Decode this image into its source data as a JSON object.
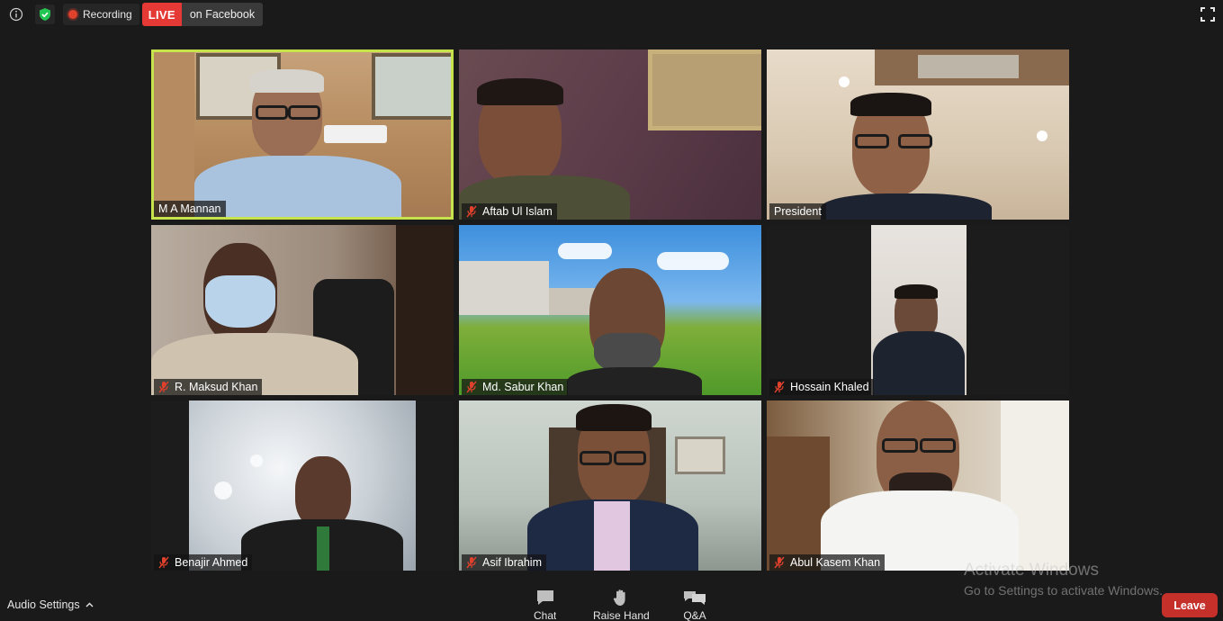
{
  "topbar": {
    "info_icon": "info-icon",
    "security_icon": "shield-check-icon",
    "recording_label": "Recording",
    "live_badge": "LIVE",
    "live_target": "on Facebook",
    "fullscreen_icon": "fullscreen-icon"
  },
  "participants": [
    {
      "name": "M A Mannan",
      "muted": false,
      "active_speaker": true
    },
    {
      "name": "Aftab Ul Islam",
      "muted": true,
      "active_speaker": false
    },
    {
      "name": "President",
      "muted": false,
      "active_speaker": false
    },
    {
      "name": "R. Maksud Khan",
      "muted": true,
      "active_speaker": false
    },
    {
      "name": "Md. Sabur Khan",
      "muted": true,
      "active_speaker": false
    },
    {
      "name": "Hossain Khaled",
      "muted": true,
      "active_speaker": false
    },
    {
      "name": "Benajir Ahmed",
      "muted": true,
      "active_speaker": false
    },
    {
      "name": "Asif Ibrahim",
      "muted": true,
      "active_speaker": false
    },
    {
      "name": "Abul Kasem Khan",
      "muted": true,
      "active_speaker": false
    }
  ],
  "bottombar": {
    "audio_settings": "Audio Settings",
    "controls": [
      {
        "label": "Chat",
        "icon": "chat-icon"
      },
      {
        "label": "Raise Hand",
        "icon": "hand-icon"
      },
      {
        "label": "Q&A",
        "icon": "qa-icon"
      }
    ],
    "leave": "Leave"
  },
  "watermark": {
    "title": "Activate Windows",
    "subtitle": "Go to Settings to activate Windows."
  },
  "colors": {
    "background": "#1a1a1a",
    "active_speaker_border": "#c7e34b",
    "live": "#e53935",
    "leave": "#c5302b",
    "muted_icon": "#e0412d"
  }
}
